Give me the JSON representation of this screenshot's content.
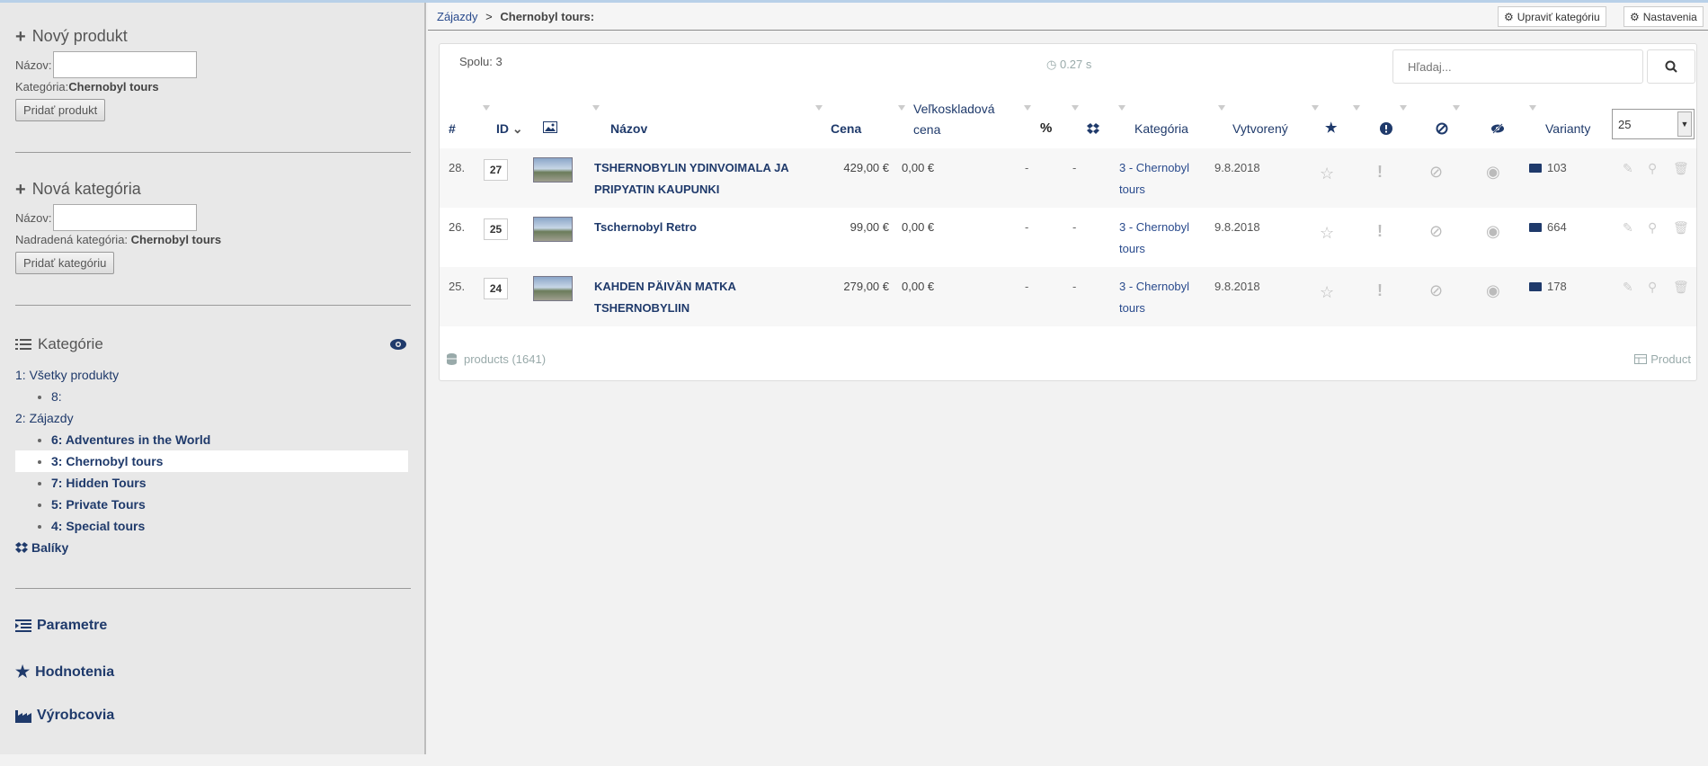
{
  "sidebar": {
    "new_product": {
      "title": "Nový produkt",
      "name_label": "Názov:",
      "category_label": "Kategória:",
      "category_value": "Chernobyl tours",
      "button": "Pridať produkt"
    },
    "new_category": {
      "title": "Nová kategória",
      "name_label": "Názov:",
      "parent_label": "Nadradená kategória:",
      "parent_value": "Chernobyl tours",
      "button": "Pridať kategóriu"
    },
    "categories": {
      "title": "Kategórie",
      "items": [
        {
          "label": "1: Všetky produkty",
          "level": 1
        },
        {
          "label": "8:",
          "level": 2
        },
        {
          "label": "2: Zájazdy",
          "level": 1
        },
        {
          "label": "6: Adventures in the World",
          "level": 2
        },
        {
          "label": "3: Chernobyl tours",
          "level": 2,
          "selected": true
        },
        {
          "label": "7: Hidden Tours",
          "level": 2
        },
        {
          "label": "5: Private Tours",
          "level": 2
        },
        {
          "label": "4: Special tours",
          "level": 2
        }
      ],
      "packages": "Balíky"
    },
    "nav": {
      "params": "Parametre",
      "ratings": "Hodnotenia",
      "makers": "Výrobcovia"
    }
  },
  "breadcrumb": {
    "parent": "Zájazdy",
    "sep": ">",
    "current": "Chernobyl tours:"
  },
  "toolbar": {
    "edit_category": "Upraviť kategóriu",
    "settings": "Nastavenia"
  },
  "table": {
    "total": "Spolu: 3",
    "time": "0.27 s",
    "search_placeholder": "Hľadaj...",
    "per_page": "25",
    "headers": {
      "hash": "#",
      "id": "ID",
      "name": "Názov",
      "price": "Cena",
      "wholesale1": "Veľkoskladová",
      "wholesale2": "cena",
      "percent": "%",
      "category": "Kategória",
      "created": "Vytvorený",
      "variants": "Varianty"
    },
    "rows": [
      {
        "num": "28.",
        "id": "27",
        "name": "TSHERNOBYLIN YDINVOIMALA JA PRIPYATIN KAUPUNKI",
        "price": "429,00 €",
        "wholesale": "0,00 €",
        "pct": "-",
        "pkg": "-",
        "category": "3 - Chernobyl tours",
        "created": "9.8.2018",
        "variants": "103"
      },
      {
        "num": "26.",
        "id": "25",
        "name": "Tschernobyl Retro",
        "price": "99,00 €",
        "wholesale": "0,00 €",
        "pct": "-",
        "pkg": "-",
        "category": "3 - Chernobyl tours",
        "created": "9.8.2018",
        "variants": "664"
      },
      {
        "num": "25.",
        "id": "24",
        "name": "KAHDEN PÄIVÄN MATKA TSHERNOBYLIIN",
        "price": "279,00 €",
        "wholesale": "0,00 €",
        "pct": "-",
        "pkg": "-",
        "category": "3 - Chernobyl tours",
        "created": "9.8.2018",
        "variants": "178"
      }
    ],
    "footer_left": "products (1641)",
    "footer_right": "Product"
  }
}
